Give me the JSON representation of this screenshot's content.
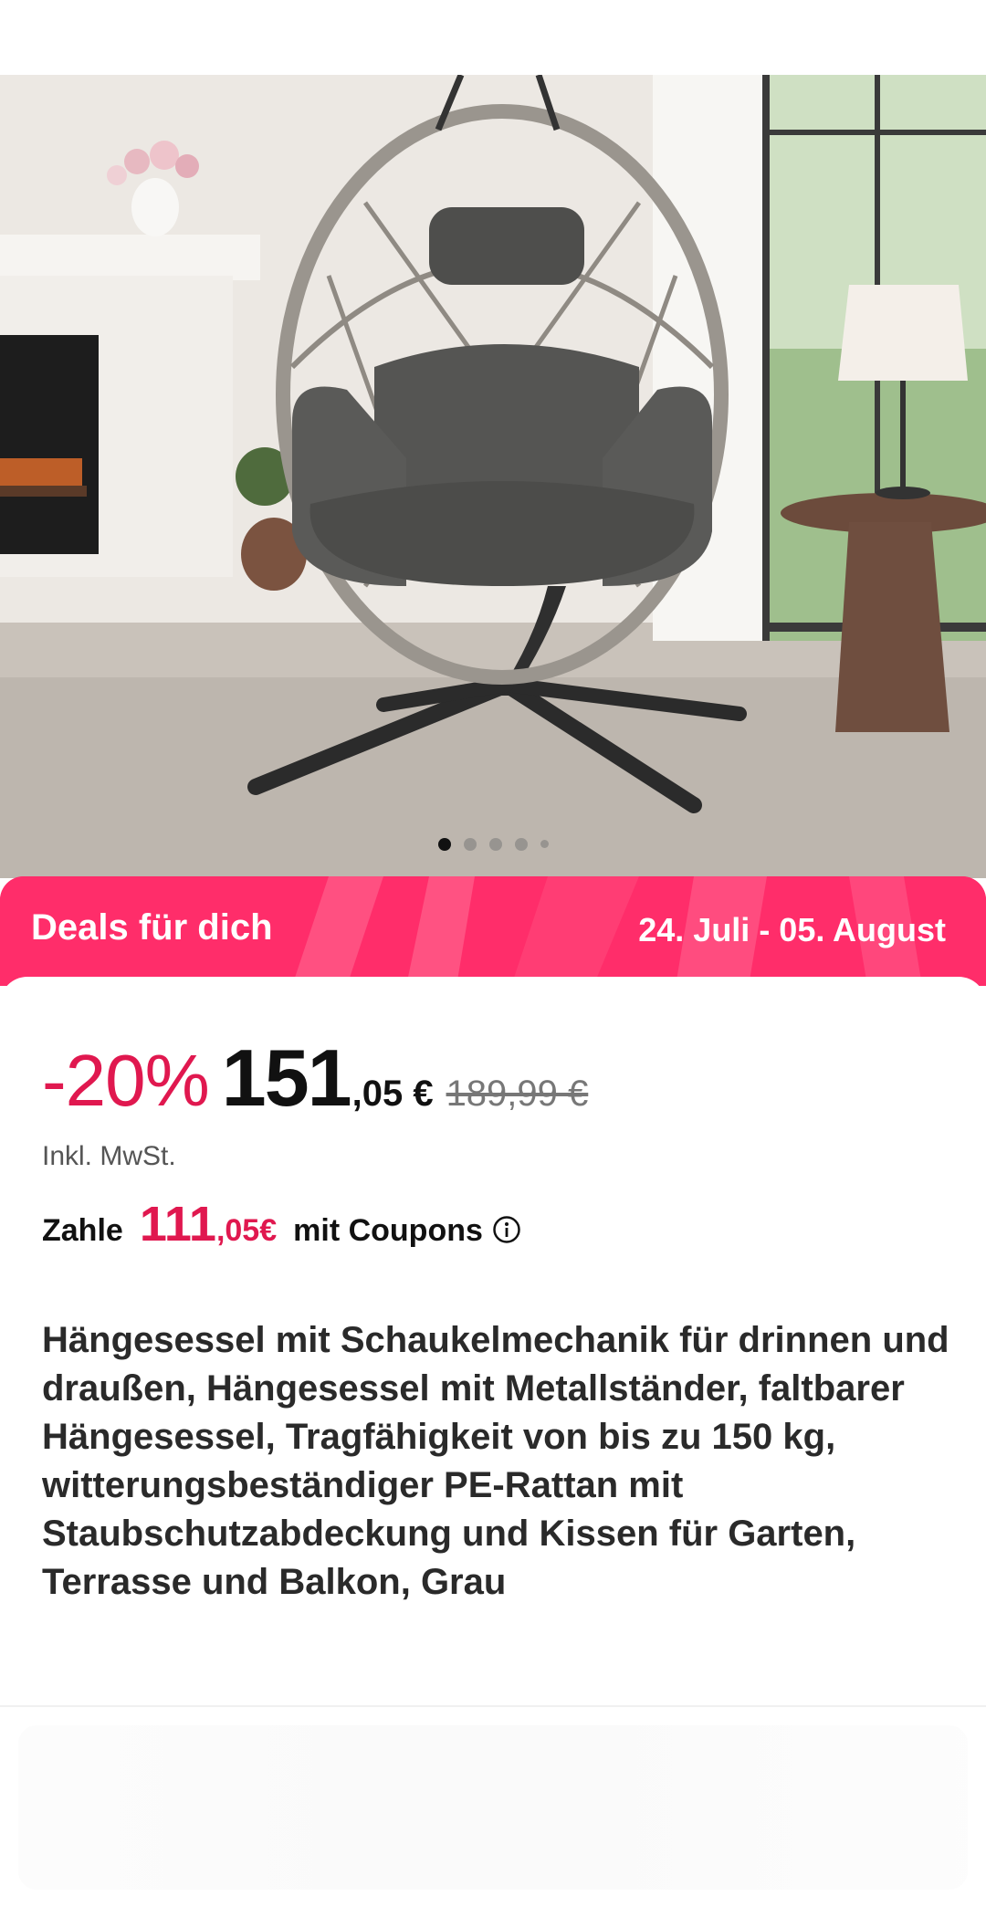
{
  "gallery": {
    "image_alt": "",
    "page_count": 5,
    "active_index": 0
  },
  "deals": {
    "label": "Deals für dich",
    "date_range": "24. Juli - 05. August",
    "color": "#ff2d6a"
  },
  "price": {
    "discount": "-20%",
    "integer": "151",
    "cents": ",05 €",
    "old_price": "189,99 €",
    "vat_note": "Inkl. MwSt."
  },
  "coupon": {
    "prefix": "Zahle",
    "integer": "111",
    "cents": ",05€",
    "suffix": "mit Coupons",
    "info_icon": "info-icon"
  },
  "product": {
    "title": "Hängesessel mit Schaukelmechanik für drinnen und draußen, Hängesessel mit Metallständer, faltbarer Hängesessel, Tragfähigkeit von bis zu 150 kg, witterungsbeständiger PE-Rattan mit Staubschutzabdeckung und Kissen für Garten, Terrasse und Balkon, Grau"
  },
  "colors": {
    "accent": "#e0184f",
    "banner": "#ff2d6a"
  }
}
